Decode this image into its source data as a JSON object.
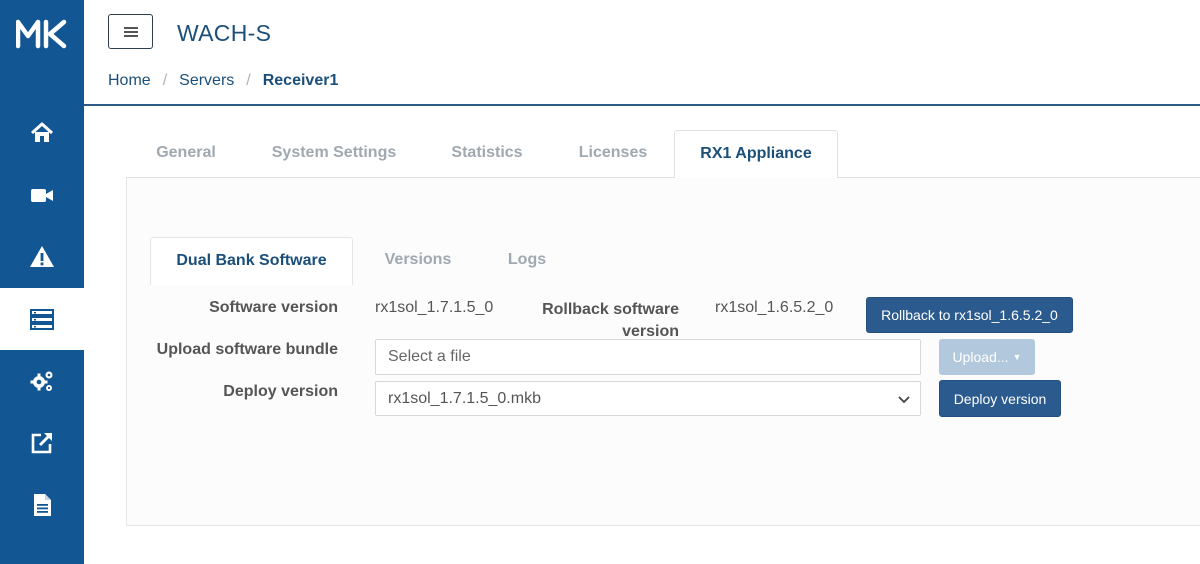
{
  "app": {
    "logo_text": "MK",
    "title": "WACH-S"
  },
  "sidebar": {
    "items": [
      {
        "icon": "home-icon",
        "active": false
      },
      {
        "icon": "video-camera-icon",
        "active": false
      },
      {
        "icon": "warning-icon",
        "active": false
      },
      {
        "icon": "servers-icon",
        "active": true
      },
      {
        "icon": "settings-cogs-icon",
        "active": false
      },
      {
        "icon": "external-link-icon",
        "active": false
      },
      {
        "icon": "document-icon",
        "active": false
      }
    ]
  },
  "breadcrumb": {
    "items": [
      "Home",
      "Servers",
      "Receiver1"
    ],
    "separator": "/"
  },
  "outer_tabs": {
    "items": [
      "General",
      "System Settings",
      "Statistics",
      "Licenses",
      "RX1 Appliance"
    ],
    "active": "RX1 Appliance"
  },
  "inner_tabs": {
    "items": [
      "Dual Bank Software",
      "Versions",
      "Logs"
    ],
    "active": "Dual Bank Software"
  },
  "form": {
    "software_version_label": "Software version",
    "software_version_value": "rx1sol_1.7.1.5_0",
    "rollback_label_line1": "Rollback software",
    "rollback_label_line2": "version",
    "rollback_value": "rx1sol_1.6.5.2_0",
    "rollback_button": "Rollback to rx1sol_1.6.5.2_0",
    "upload_label": "Upload software bundle",
    "upload_placeholder": "Select a file",
    "upload_button": "Upload...",
    "deploy_label": "Deploy version",
    "deploy_selected": "rx1sol_1.7.1.5_0.mkb",
    "deploy_button": "Deploy version"
  },
  "colors": {
    "sidebar_bg": "#135694",
    "accent_text": "#1b4f7a",
    "primary_button": "#2b5b8e",
    "disabled_button": "#b2c8dc"
  }
}
